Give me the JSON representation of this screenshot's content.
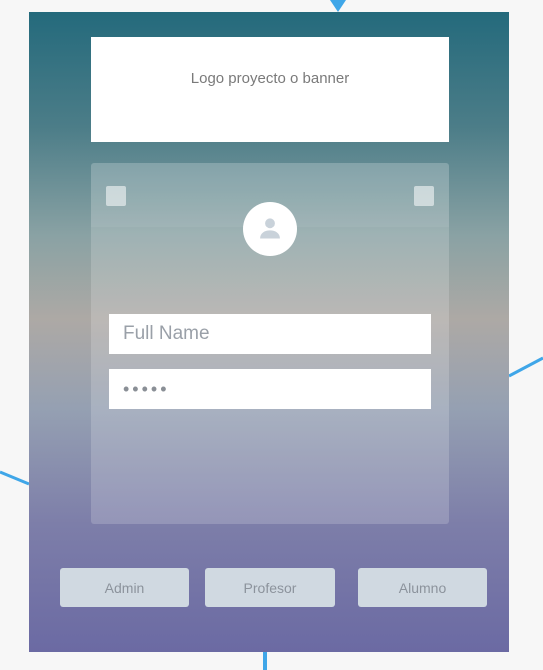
{
  "banner": {
    "text": "Logo proyecto o banner"
  },
  "login": {
    "avatar_icon": "user-icon",
    "name_placeholder": "Full Name",
    "password_value": "•••••"
  },
  "roles": {
    "admin_label": "Admin",
    "profesor_label": "Profesor",
    "alumno_label": "Alumno"
  },
  "colors": {
    "accent_line": "#3fa6e8",
    "button_bg": "#d0d9e1",
    "panel_top": "#246a7c",
    "panel_bottom": "#6b6aa3"
  }
}
